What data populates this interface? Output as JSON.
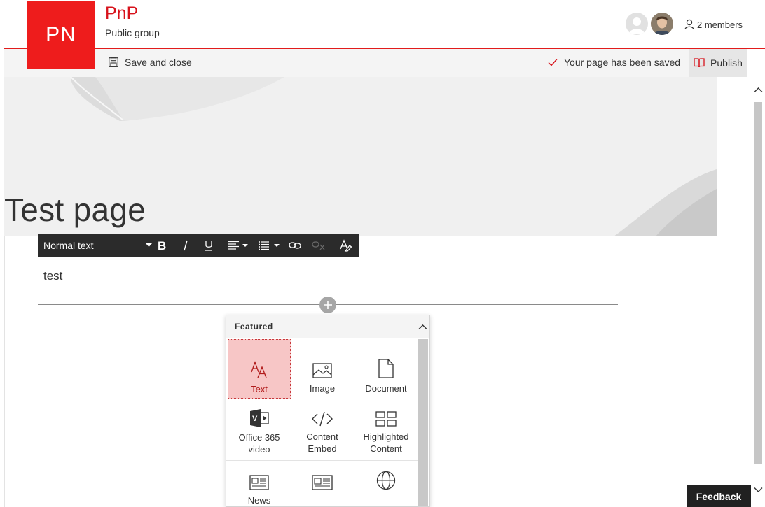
{
  "site": {
    "logo_text": "PN",
    "title": "PnP",
    "subtitle": "Public group",
    "members_label": "2 members",
    "accent_color": "#d7121b"
  },
  "commandbar": {
    "save_close_label": "Save and close",
    "saved_status": "Your page has been saved",
    "publish_label": "Publish"
  },
  "page": {
    "title": "Test page",
    "text_content": "test"
  },
  "text_toolbar": {
    "style_value": "Normal text",
    "buttons": [
      "bold",
      "italic",
      "underline",
      "align",
      "list",
      "link",
      "unlink",
      "clear-formatting"
    ]
  },
  "toolbox": {
    "section_title": "Featured",
    "tiles": [
      {
        "label": "Text",
        "icon": "text-icon",
        "selected": true
      },
      {
        "label": "Image",
        "icon": "image-icon"
      },
      {
        "label": "Document",
        "icon": "document-icon"
      },
      {
        "label_line1": "Office 365",
        "label_line2": "video",
        "icon": "office365-video-icon"
      },
      {
        "label_line1": "Content",
        "label_line2": "Embed",
        "icon": "code-icon"
      },
      {
        "label_line1": "Highlighted",
        "label_line2": "Content",
        "icon": "highlighted-content-icon"
      },
      {
        "label": "News",
        "icon": "news-icon"
      },
      {
        "label": "",
        "icon": "newslist-icon"
      },
      {
        "label": "",
        "icon": "globe-icon"
      }
    ]
  },
  "feedback_label": "Feedback"
}
